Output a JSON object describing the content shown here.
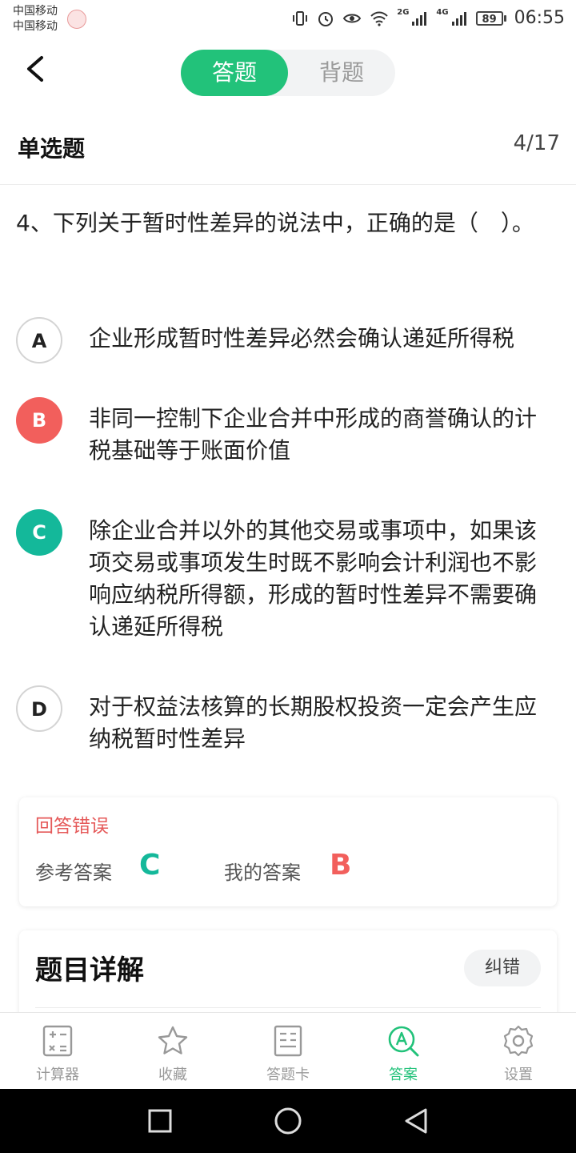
{
  "status_bar": {
    "carrier1": "中国移动",
    "carrier2": "中国移动",
    "net1": "2G",
    "net2": "4G",
    "battery": "89",
    "time": "06:55"
  },
  "header": {
    "tabs": [
      {
        "label": "答题",
        "active": true
      },
      {
        "label": "背题",
        "active": false
      }
    ]
  },
  "question_bar": {
    "type": "单选题",
    "progress": "4/17"
  },
  "question": {
    "text": "4、下列关于暂时性差异的说法中，正确的是（　）。",
    "options": [
      {
        "letter": "A",
        "text": "企业形成暂时性差异必然会确认递延所得税",
        "state": "plain"
      },
      {
        "letter": "B",
        "text": "非同一控制下企业合并中形成的商誉确认的计税基础等于账面价值",
        "state": "wrong"
      },
      {
        "letter": "C",
        "text": "除企业合并以外的其他交易或事项中，如果该项交易或事项发生时既不影响会计利润也不影响应纳税所得额，形成的暂时性差异不需要确认递延所得税",
        "state": "right"
      },
      {
        "letter": "D",
        "text": "对于权益法核算的长期股权投资一定会产生应纳税暂时性差异",
        "state": "plain"
      }
    ]
  },
  "result": {
    "title": "回答错误",
    "ref_label": "参考答案",
    "ref_value": "C",
    "my_label": "我的答案",
    "my_value": "B"
  },
  "detail": {
    "title": "题目详解",
    "correct_button": "纠错"
  },
  "bottom_nav": [
    {
      "label": "计算器",
      "icon": "calculator-icon",
      "active": false
    },
    {
      "label": "收藏",
      "icon": "star-icon",
      "active": false
    },
    {
      "label": "答题卡",
      "icon": "answer-card-icon",
      "active": false
    },
    {
      "label": "答案",
      "icon": "answer-search-icon",
      "active": true
    },
    {
      "label": "设置",
      "icon": "gear-icon",
      "active": false
    }
  ],
  "colors": {
    "accent_green": "#22c27a",
    "correct_teal": "#14b89a",
    "wrong_red": "#f25f5c"
  }
}
